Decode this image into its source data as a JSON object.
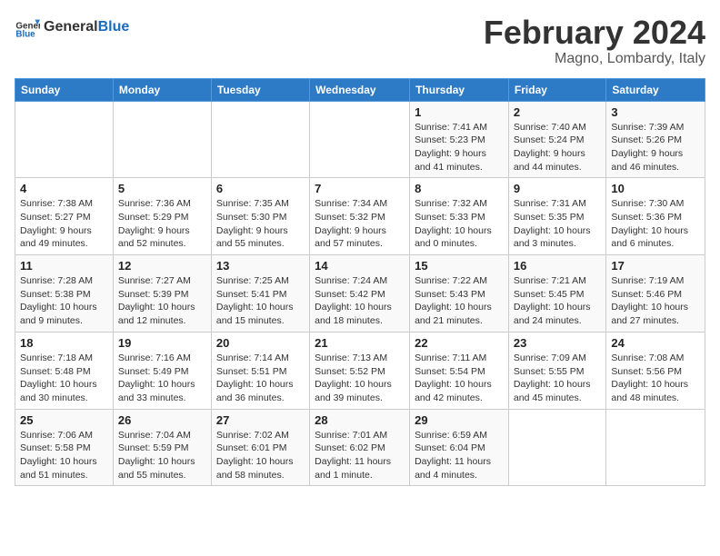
{
  "header": {
    "logo_line1": "General",
    "logo_line2": "Blue",
    "month": "February 2024",
    "location": "Magno, Lombardy, Italy"
  },
  "days_of_week": [
    "Sunday",
    "Monday",
    "Tuesday",
    "Wednesday",
    "Thursday",
    "Friday",
    "Saturday"
  ],
  "weeks": [
    [
      {
        "num": "",
        "detail": ""
      },
      {
        "num": "",
        "detail": ""
      },
      {
        "num": "",
        "detail": ""
      },
      {
        "num": "",
        "detail": ""
      },
      {
        "num": "1",
        "detail": "Sunrise: 7:41 AM\nSunset: 5:23 PM\nDaylight: 9 hours\nand 41 minutes."
      },
      {
        "num": "2",
        "detail": "Sunrise: 7:40 AM\nSunset: 5:24 PM\nDaylight: 9 hours\nand 44 minutes."
      },
      {
        "num": "3",
        "detail": "Sunrise: 7:39 AM\nSunset: 5:26 PM\nDaylight: 9 hours\nand 46 minutes."
      }
    ],
    [
      {
        "num": "4",
        "detail": "Sunrise: 7:38 AM\nSunset: 5:27 PM\nDaylight: 9 hours\nand 49 minutes."
      },
      {
        "num": "5",
        "detail": "Sunrise: 7:36 AM\nSunset: 5:29 PM\nDaylight: 9 hours\nand 52 minutes."
      },
      {
        "num": "6",
        "detail": "Sunrise: 7:35 AM\nSunset: 5:30 PM\nDaylight: 9 hours\nand 55 minutes."
      },
      {
        "num": "7",
        "detail": "Sunrise: 7:34 AM\nSunset: 5:32 PM\nDaylight: 9 hours\nand 57 minutes."
      },
      {
        "num": "8",
        "detail": "Sunrise: 7:32 AM\nSunset: 5:33 PM\nDaylight: 10 hours\nand 0 minutes."
      },
      {
        "num": "9",
        "detail": "Sunrise: 7:31 AM\nSunset: 5:35 PM\nDaylight: 10 hours\nand 3 minutes."
      },
      {
        "num": "10",
        "detail": "Sunrise: 7:30 AM\nSunset: 5:36 PM\nDaylight: 10 hours\nand 6 minutes."
      }
    ],
    [
      {
        "num": "11",
        "detail": "Sunrise: 7:28 AM\nSunset: 5:38 PM\nDaylight: 10 hours\nand 9 minutes."
      },
      {
        "num": "12",
        "detail": "Sunrise: 7:27 AM\nSunset: 5:39 PM\nDaylight: 10 hours\nand 12 minutes."
      },
      {
        "num": "13",
        "detail": "Sunrise: 7:25 AM\nSunset: 5:41 PM\nDaylight: 10 hours\nand 15 minutes."
      },
      {
        "num": "14",
        "detail": "Sunrise: 7:24 AM\nSunset: 5:42 PM\nDaylight: 10 hours\nand 18 minutes."
      },
      {
        "num": "15",
        "detail": "Sunrise: 7:22 AM\nSunset: 5:43 PM\nDaylight: 10 hours\nand 21 minutes."
      },
      {
        "num": "16",
        "detail": "Sunrise: 7:21 AM\nSunset: 5:45 PM\nDaylight: 10 hours\nand 24 minutes."
      },
      {
        "num": "17",
        "detail": "Sunrise: 7:19 AM\nSunset: 5:46 PM\nDaylight: 10 hours\nand 27 minutes."
      }
    ],
    [
      {
        "num": "18",
        "detail": "Sunrise: 7:18 AM\nSunset: 5:48 PM\nDaylight: 10 hours\nand 30 minutes."
      },
      {
        "num": "19",
        "detail": "Sunrise: 7:16 AM\nSunset: 5:49 PM\nDaylight: 10 hours\nand 33 minutes."
      },
      {
        "num": "20",
        "detail": "Sunrise: 7:14 AM\nSunset: 5:51 PM\nDaylight: 10 hours\nand 36 minutes."
      },
      {
        "num": "21",
        "detail": "Sunrise: 7:13 AM\nSunset: 5:52 PM\nDaylight: 10 hours\nand 39 minutes."
      },
      {
        "num": "22",
        "detail": "Sunrise: 7:11 AM\nSunset: 5:54 PM\nDaylight: 10 hours\nand 42 minutes."
      },
      {
        "num": "23",
        "detail": "Sunrise: 7:09 AM\nSunset: 5:55 PM\nDaylight: 10 hours\nand 45 minutes."
      },
      {
        "num": "24",
        "detail": "Sunrise: 7:08 AM\nSunset: 5:56 PM\nDaylight: 10 hours\nand 48 minutes."
      }
    ],
    [
      {
        "num": "25",
        "detail": "Sunrise: 7:06 AM\nSunset: 5:58 PM\nDaylight: 10 hours\nand 51 minutes."
      },
      {
        "num": "26",
        "detail": "Sunrise: 7:04 AM\nSunset: 5:59 PM\nDaylight: 10 hours\nand 55 minutes."
      },
      {
        "num": "27",
        "detail": "Sunrise: 7:02 AM\nSunset: 6:01 PM\nDaylight: 10 hours\nand 58 minutes."
      },
      {
        "num": "28",
        "detail": "Sunrise: 7:01 AM\nSunset: 6:02 PM\nDaylight: 11 hours\nand 1 minute."
      },
      {
        "num": "29",
        "detail": "Sunrise: 6:59 AM\nSunset: 6:04 PM\nDaylight: 11 hours\nand 4 minutes."
      },
      {
        "num": "",
        "detail": ""
      },
      {
        "num": "",
        "detail": ""
      }
    ]
  ]
}
